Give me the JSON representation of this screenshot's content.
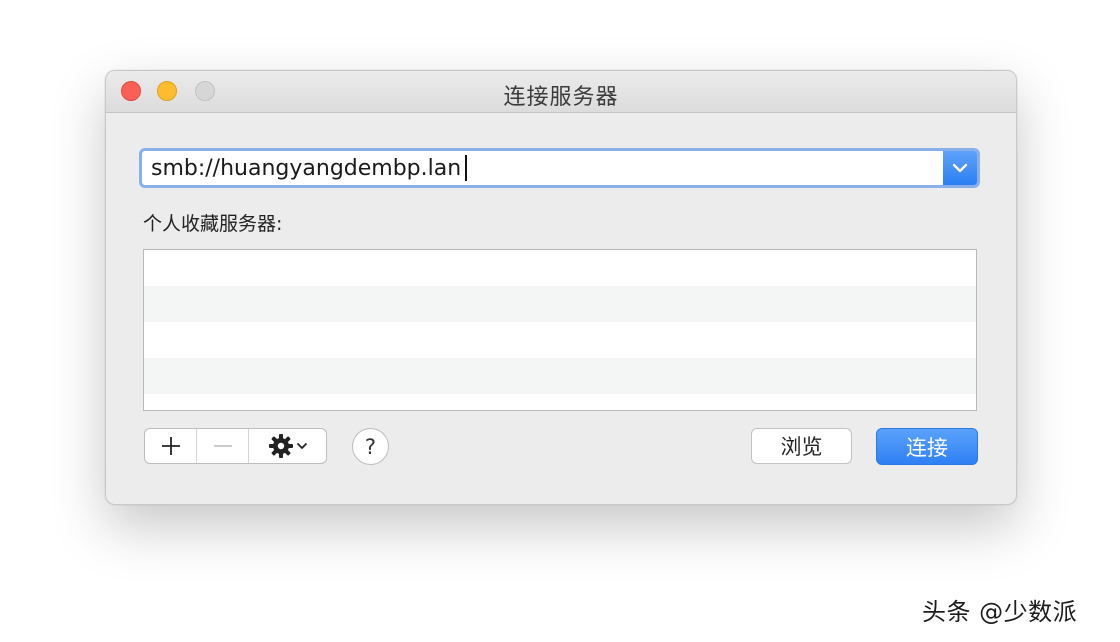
{
  "window": {
    "title": "连接服务器"
  },
  "server_address": {
    "value": "smb://huangyangdembp.lan"
  },
  "favorites": {
    "label": "个人收藏服务器:",
    "rows": [
      "",
      "",
      "",
      "",
      ""
    ]
  },
  "toolbar": {
    "add_label": "+",
    "remove_label": "—",
    "help_label": "?"
  },
  "buttons": {
    "browse_label": "浏览",
    "connect_label": "连接"
  },
  "watermark": {
    "text": "头条 @少数派"
  },
  "colors": {
    "accent": "#2f80f4",
    "close": "#fc5f57",
    "minimize": "#fdbc2e",
    "zoom_disabled": "#d6d6d6"
  },
  "icons": {
    "dropdown": "chevron-down-icon",
    "gear": "gear-icon"
  }
}
